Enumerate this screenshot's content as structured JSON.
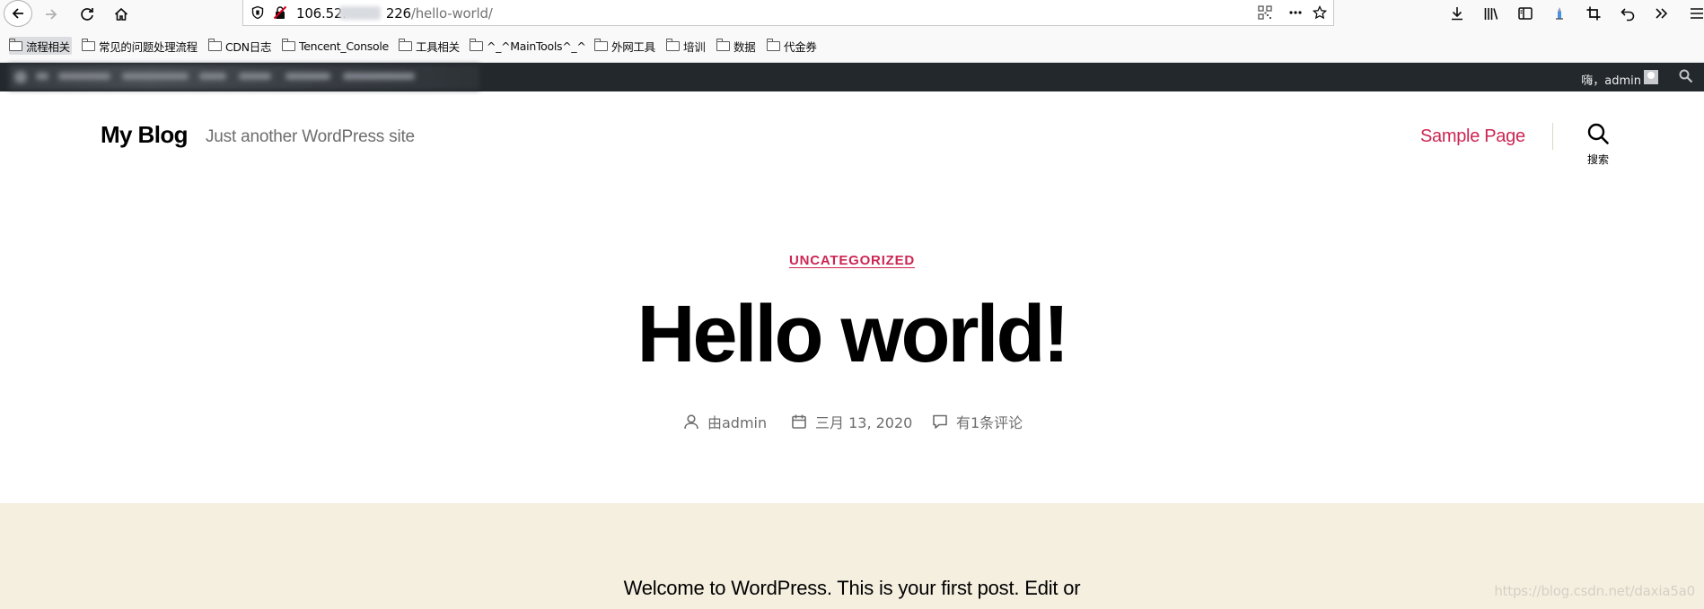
{
  "browser": {
    "url_host": "106.52.",
    "url_host_tail": "226",
    "url_path": "/hello-world/"
  },
  "bookmarks": [
    {
      "label": "流程相关"
    },
    {
      "label": "常见的问题处理流程"
    },
    {
      "label": "CDN日志"
    },
    {
      "label": "Tencent_Console"
    },
    {
      "label": "工具相关"
    },
    {
      "label": "^_^MainTools^_^"
    },
    {
      "label": "外网工具"
    },
    {
      "label": "培训"
    },
    {
      "label": "数据"
    },
    {
      "label": "代金券"
    }
  ],
  "adminbar": {
    "howdy": "嗨，admin"
  },
  "header": {
    "site_title": "My Blog",
    "site_description": "Just another WordPress site",
    "nav_link": "Sample Page",
    "search_label": "搜索"
  },
  "post": {
    "category": "UNCATEGORIZED",
    "title": "Hello world!",
    "author": "由admin",
    "date": "三月 13, 2020",
    "comments": "有1条评论",
    "excerpt": "Welcome to WordPress. This is your first post. Edit or"
  },
  "watermark": "https://blog.csdn.net/daxia5a0",
  "colors": {
    "accent": "#cd2653",
    "adminbar": "#23282d",
    "content_bg": "#f5efe0"
  }
}
